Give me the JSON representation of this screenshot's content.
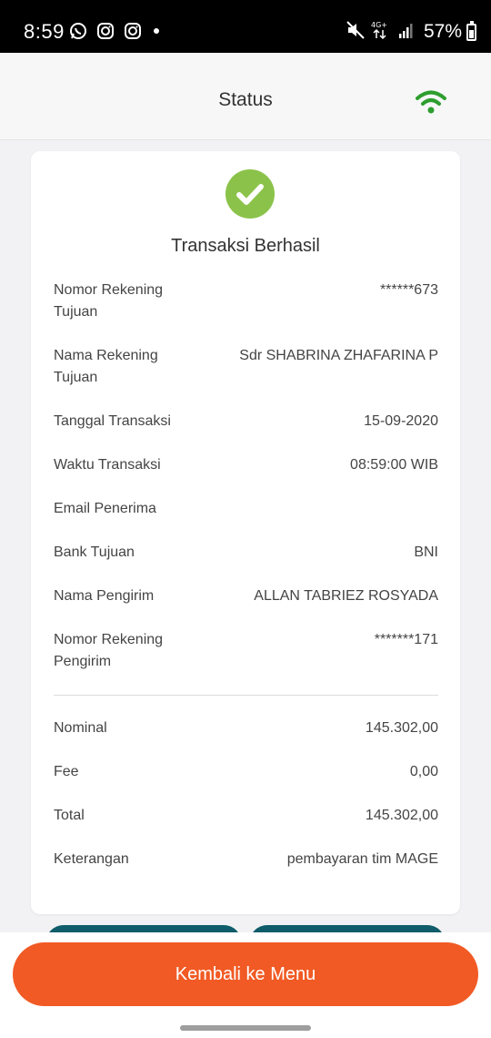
{
  "status_bar": {
    "time": "8:59",
    "battery": "57%",
    "network": "4G+"
  },
  "header": {
    "title": "Status",
    "connection_icon": "wifi-icon",
    "connection_color": "#2e9e2e"
  },
  "receipt": {
    "success_icon": "check-circle-icon",
    "success_color": "#8bc34a",
    "title": "Transaksi Berhasil",
    "details": [
      {
        "label": "Nomor Rekening Tujuan",
        "value": "******673"
      },
      {
        "label": "Nama Rekening Tujuan",
        "value": "Sdr SHABRINA ZHAFARINA P"
      },
      {
        "label": "Tanggal Transaksi",
        "value": "15-09-2020"
      },
      {
        "label": "Waktu Transaksi",
        "value": "08:59:00 WIB"
      },
      {
        "label": "Email Penerima",
        "value": ""
      },
      {
        "label": "Bank Tujuan",
        "value": "BNI"
      },
      {
        "label": "Nama Pengirim",
        "value": "ALLAN TABRIEZ ROSYADA"
      },
      {
        "label": "Nomor Rekening Pengirim",
        "value": "*******171"
      }
    ],
    "amounts": [
      {
        "label": "Nominal",
        "value": "145.302,00"
      },
      {
        "label": "Fee",
        "value": "0,00"
      },
      {
        "label": "Total",
        "value": "145.302,00"
      },
      {
        "label": "Keterangan",
        "value": "pembayaran tim MAGE"
      }
    ]
  },
  "actions": {
    "back_to_menu": "Kembali ke Menu",
    "primary_color": "#f15a24",
    "secondary_color": "#0f5c6a"
  }
}
